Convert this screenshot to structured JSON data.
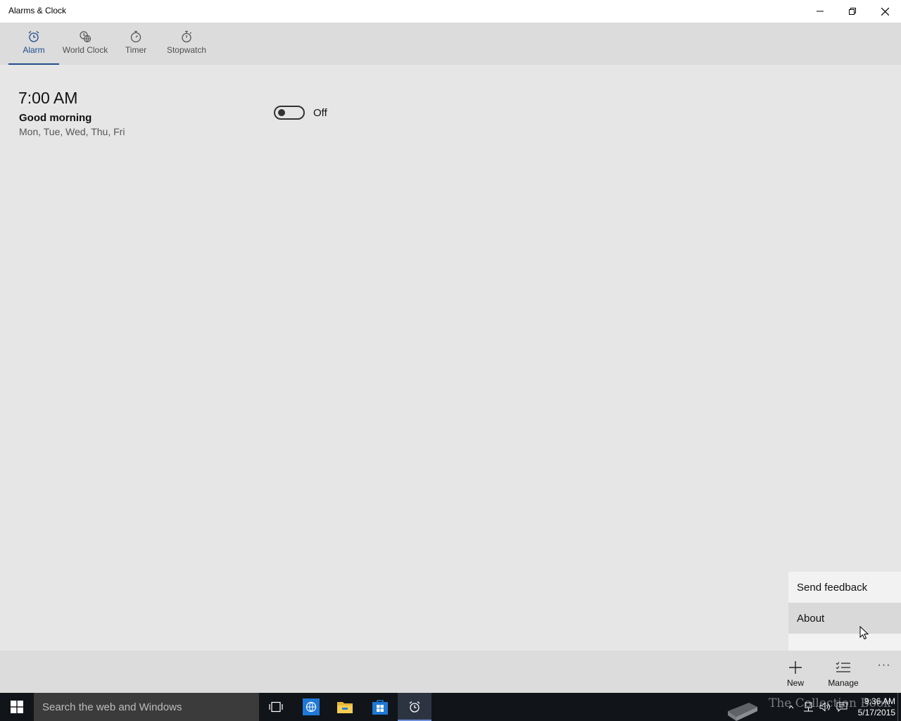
{
  "window": {
    "title": "Alarms & Clock",
    "controls": [
      "minimize-icon",
      "restore-icon",
      "close-icon"
    ]
  },
  "tabs": [
    {
      "label": "Alarm",
      "icon": "alarm-clock-icon",
      "active": true
    },
    {
      "label": "World Clock",
      "icon": "globe-clock-icon",
      "active": false
    },
    {
      "label": "Timer",
      "icon": "timer-icon",
      "active": false
    },
    {
      "label": "Stopwatch",
      "icon": "stopwatch-icon",
      "active": false
    }
  ],
  "alarm": {
    "time": "7:00 AM",
    "name": "Good morning",
    "days": "Mon, Tue, Wed, Thu, Fri",
    "state_label": "Off",
    "enabled": false
  },
  "overflow_menu": {
    "items": [
      {
        "label": "Send feedback",
        "highlighted": false
      },
      {
        "label": "About",
        "highlighted": true
      }
    ]
  },
  "appbar": {
    "new_label": "New",
    "new_icon": "plus-icon",
    "manage_label": "Manage",
    "manage_icon": "checklist-icon",
    "more_label": "···",
    "more_icon": "more-options-icon"
  },
  "taskbar": {
    "search_placeholder": "Search the web and Windows",
    "apps": [
      "task-view-icon",
      "browser-icon",
      "file-explorer-icon",
      "store-icon",
      "alarms-app-icon"
    ],
    "watermark_text": "The Collection Book",
    "clock_time": "9:36 AM",
    "clock_date": "5/17/2015"
  },
  "colors": {
    "accent": "#1f4e8c",
    "background": "#e6e6e6",
    "bars": "#dcdcdc",
    "taskbar": "#111418",
    "search_box": "#3b3b3b"
  }
}
